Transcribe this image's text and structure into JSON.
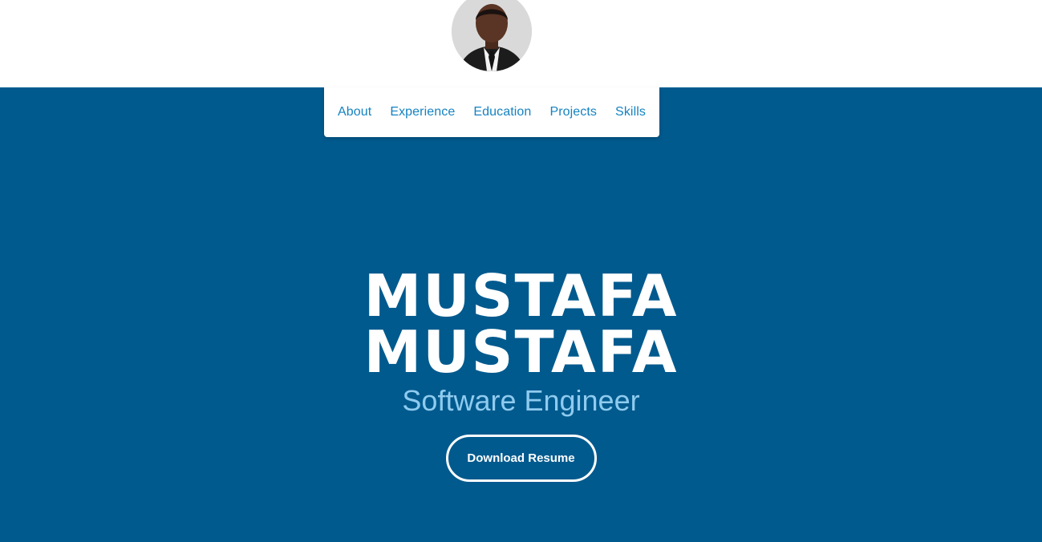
{
  "nav": {
    "items": [
      {
        "label": "About"
      },
      {
        "label": "Experience"
      },
      {
        "label": "Education"
      },
      {
        "label": "Projects"
      },
      {
        "label": "Skills"
      }
    ]
  },
  "hero": {
    "name_line_1": "MUSTAFA",
    "name_line_2": "MUSTAFA",
    "subtitle": "Software Engineer",
    "resume_button_label": "Download Resume"
  },
  "colors": {
    "hero_background": "#005a8e",
    "nav_link": "#1583c1",
    "subtitle": "#8fcbef",
    "header_background": "#ffffff"
  },
  "icons": {
    "avatar": "profile-photo"
  }
}
